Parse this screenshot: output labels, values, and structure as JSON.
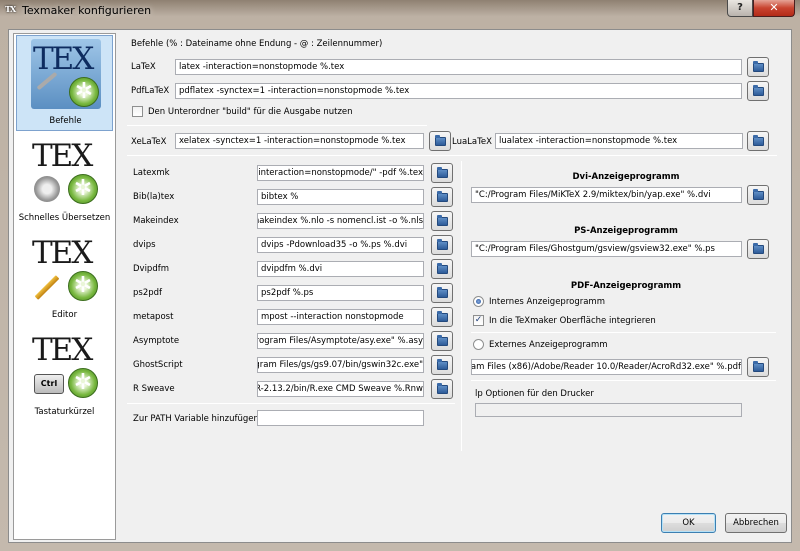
{
  "window": {
    "title": "Texmaker konfigurieren",
    "help_label": "?",
    "close_label": "✕"
  },
  "sidebar": {
    "items": [
      {
        "label": "Befehle",
        "icon": "tex-tools-icon",
        "selected": true
      },
      {
        "label": "Schnelles Übersetzen",
        "icon": "tex-quick-build-icon",
        "selected": false
      },
      {
        "label": "Editor",
        "icon": "tex-editor-icon",
        "selected": false
      },
      {
        "label": "Tastaturkürzel",
        "icon": "tex-shortcuts-icon",
        "selected": false
      }
    ]
  },
  "commands": {
    "header": "Befehle (% : Dateiname ohne Endung - @ : Zeilennummer)",
    "latex": {
      "label": "LaTeX",
      "value": "latex -interaction=nonstopmode %.tex"
    },
    "pdflatex": {
      "label": "PdfLaTeX",
      "value": "pdflatex -synctex=1 -interaction=nonstopmode %.tex"
    },
    "build_subdir": {
      "label": "Den Unterordner \"build\" für die Ausgabe nutzen",
      "checked": false
    },
    "xelatex": {
      "label": "XeLaTeX",
      "value": "xelatex -synctex=1 -interaction=nonstopmode %.tex"
    },
    "lualatex": {
      "label": "LuaLaTeX",
      "value": "lualatex -interaction=nonstopmode %.tex"
    }
  },
  "tools": [
    {
      "label": "Latexmk",
      "value": "=1 -interaction=nonstopmode/\" -pdf %.tex"
    },
    {
      "label": "Bib(la)tex",
      "value": "bibtex %"
    },
    {
      "label": "Makeindex",
      "value": "x|makeindex %.nlo -s nomencl.ist -o %.nls"
    },
    {
      "label": "dvips",
      "value": "dvips -Pdownload35 -o %.ps %.dvi"
    },
    {
      "label": "Dvipdfm",
      "value": "dvipdfm %.dvi"
    },
    {
      "label": "ps2pdf",
      "value": "ps2pdf %.ps"
    },
    {
      "label": "metapost",
      "value": "mpost --interaction nonstopmode"
    },
    {
      "label": "Asymptote",
      "value": "/Program Files/Asymptote/asy.exe\" %.asy"
    },
    {
      "label": "GhostScript",
      "value": "Program Files/gs/gs9.07/bin/gswin32c.exe\""
    },
    {
      "label": "R Sweave",
      "value": "\\/R-2.13.2/bin/R.exe CMD Sweave %.Rnw"
    }
  ],
  "path_var": {
    "label": "Zur PATH Variable hinzufügen",
    "value": ""
  },
  "viewers": {
    "dvi": {
      "heading": "Dvi-Anzeigeprogramm",
      "value": "\"C:/Program Files/MiKTeX 2.9/miktex/bin/yap.exe\" %.dvi"
    },
    "ps": {
      "heading": "PS-Anzeigeprogramm",
      "value": "\"C:/Program Files/Ghostgum/gsview/gsview32.exe\" %.ps"
    },
    "pdf": {
      "heading": "PDF-Anzeigeprogramm",
      "internal_label": "Internes Anzeigeprogramm",
      "internal_selected": true,
      "integrate_label": "In die TeXmaker Oberfläche integrieren",
      "integrate_checked": true,
      "external_label": "Externes Anzeigeprogramm",
      "external_selected": false,
      "external_value": "ogram Files (x86)/Adobe/Reader 10.0/Reader/AcroRd32.exe\" %.pdf",
      "printer_label": "lp Optionen für den Drucker",
      "printer_value": ""
    }
  },
  "buttons": {
    "ok": "OK",
    "cancel": "Abbrechen"
  },
  "colors": {
    "selection": "#cde4f7",
    "close_button": "#c8432f"
  }
}
